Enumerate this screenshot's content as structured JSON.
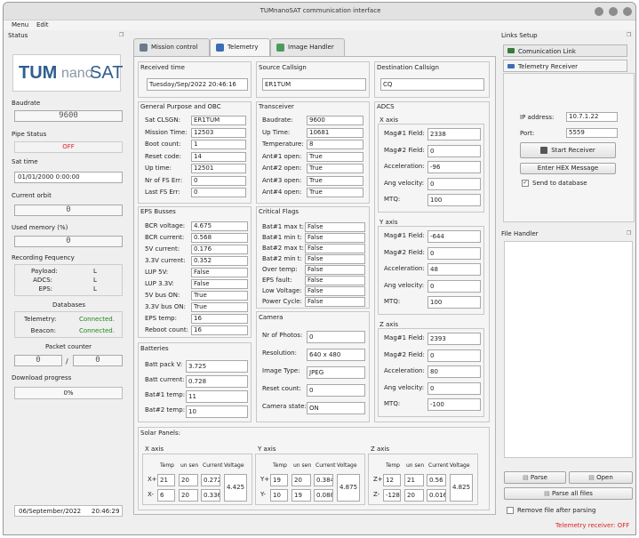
{
  "window": {
    "title": "TUMnanoSAT communication interface"
  },
  "menu": {
    "items": [
      "Menu",
      "Edit"
    ]
  },
  "left": {
    "status_title": "Status",
    "logo": {
      "text_tum": "TUM",
      "text_nano": "nano",
      "text_sat": "SAT"
    },
    "baudrate_label": "Baudrate",
    "baudrate_value": "9600",
    "pipe_status_label": "Pipe Status",
    "pipe_status_value": "OFF",
    "sat_time_label": "Sat time",
    "sat_time_value": "01/01/2000  0:00:00",
    "current_orbit_label": "Current orbit",
    "current_orbit_value": "0",
    "used_memory_label": "Used memory (%)",
    "used_memory_value": "0",
    "recording_label": "Recording Fequency",
    "recording_rows": [
      {
        "name": "Payload:",
        "value": "L"
      },
      {
        "name": "ADCS:",
        "value": "L"
      },
      {
        "name": "EPS:",
        "value": "L"
      }
    ],
    "databases_label": "Databases",
    "database_rows": [
      {
        "name": "Telemetry:",
        "value": "Connected."
      },
      {
        "name": "Beacon:",
        "value": "Connected."
      }
    ],
    "packet_counter_label": "Packet counter",
    "packet_counter_left": "0",
    "packet_counter_sep": "/",
    "packet_counter_right": "0",
    "download_label": "Download progress",
    "download_value": "0%",
    "footer_date": "06/September/2022",
    "footer_time": "20:46:29"
  },
  "tabs": [
    {
      "label": "Mission control"
    },
    {
      "label": "Telemetry"
    },
    {
      "label": "Image Handler"
    }
  ],
  "telemetry": {
    "received_time_label": "Received time",
    "received_time_value": "Tuesday/Sep/2022    20:46:16",
    "source_callsign_label": "Source Callsign",
    "source_callsign_value": "ER1TUM",
    "dest_callsign_label": "Destination Callsign",
    "dest_callsign_value": "CQ",
    "gp_title": "General Purpose and OBC",
    "gp_rows": [
      {
        "label": "Sat CLSGN:",
        "value": "ER1TUM"
      },
      {
        "label": "Mission Time:",
        "value": "12503"
      },
      {
        "label": "Boot count:",
        "value": "1"
      },
      {
        "label": "Reset code:",
        "value": "14"
      },
      {
        "label": "Up time:",
        "value": "12501"
      },
      {
        "label": "Nr of FS Err:",
        "value": "0"
      },
      {
        "label": "Last FS Err:",
        "value": "0"
      }
    ],
    "trx_title": "Transceiver",
    "trx_rows": [
      {
        "label": "Baudrate:",
        "value": "9600"
      },
      {
        "label": "Up Time:",
        "value": "10681"
      },
      {
        "label": "Temperature:",
        "value": "8"
      },
      {
        "label": "Ant#1 open:",
        "value": "True"
      },
      {
        "label": "Ant#2 open:",
        "value": "True"
      },
      {
        "label": "Ant#3 open:",
        "value": "True"
      },
      {
        "label": "Ant#4 open:",
        "value": "True"
      }
    ],
    "eps_title": "EPS Busses",
    "eps_rows": [
      {
        "label": "BCR voltage:",
        "value": "4.675"
      },
      {
        "label": "BCR current:",
        "value": "0.568"
      },
      {
        "label": "5V current:",
        "value": "0.176"
      },
      {
        "label": "3.3V current:",
        "value": "0.352"
      },
      {
        "label": "LUP 5V:",
        "value": "False"
      },
      {
        "label": "LUP 3.3V:",
        "value": "False"
      },
      {
        "label": "5V bus ON:",
        "value": "True"
      },
      {
        "label": "3.3V bus ON:",
        "value": "True"
      },
      {
        "label": "EPS temp:",
        "value": "16"
      },
      {
        "label": "Reboot count:",
        "value": "16"
      }
    ],
    "crit_title": "Critical Flags",
    "crit_rows": [
      {
        "label": "Bat#1 max t:",
        "value": "False"
      },
      {
        "label": "Bat#1 min t:",
        "value": "False"
      },
      {
        "label": "Bat#2 max t:",
        "value": "False"
      },
      {
        "label": "Bat#2 min t:",
        "value": "False"
      },
      {
        "label": "Over temp:",
        "value": "False"
      },
      {
        "label": "EPS fault:",
        "value": "False"
      },
      {
        "label": "Low Voltage:",
        "value": "False"
      },
      {
        "label": "Power Cycle:",
        "value": "False"
      }
    ],
    "bat_title": "Batteries",
    "bat_rows": [
      {
        "label": "Batt pack V:",
        "value": "3.725"
      },
      {
        "label": "Batt current:",
        "value": "0.728"
      },
      {
        "label": "Bat#1 temp:",
        "value": "11"
      },
      {
        "label": "Bat#2 temp:",
        "value": "10"
      }
    ],
    "cam_title": "Camera",
    "cam_rows": [
      {
        "label": "Nr of Photos:",
        "value": "0"
      },
      {
        "label": "Resolution:",
        "value": "640 x 480"
      },
      {
        "label": "Image Type:",
        "value": "JPEG"
      },
      {
        "label": "Reset count:",
        "value": "0"
      },
      {
        "label": "Camera state:",
        "value": "ON"
      }
    ],
    "adcs_title": "ADCS",
    "adcs_axes": [
      {
        "title": "X axis",
        "rows": [
          {
            "label": "Mag#1 Field:",
            "value": "2338"
          },
          {
            "label": "Mag#2 Field:",
            "value": "0"
          },
          {
            "label": "Acceleration:",
            "value": "-96"
          },
          {
            "label": "Ang velocity:",
            "value": "0"
          },
          {
            "label": "MTQ:",
            "value": "100"
          }
        ]
      },
      {
        "title": "Y axis",
        "rows": [
          {
            "label": "Mag#1 Field:",
            "value": "-644"
          },
          {
            "label": "Mag#2 Field:",
            "value": "0"
          },
          {
            "label": "Acceleration:",
            "value": "48"
          },
          {
            "label": "Ang velocity:",
            "value": "0"
          },
          {
            "label": "MTQ:",
            "value": "100"
          }
        ]
      },
      {
        "title": "Z axis",
        "rows": [
          {
            "label": "Mag#1 Field:",
            "value": "2393"
          },
          {
            "label": "Mag#2 Field:",
            "value": "0"
          },
          {
            "label": "Acceleration:",
            "value": "80"
          },
          {
            "label": "Ang velocity:",
            "value": "0"
          },
          {
            "label": "MTQ:",
            "value": "-100"
          }
        ]
      }
    ],
    "solar_title": "Solar Panels:",
    "solar_headers": [
      "Temp",
      "un sen",
      "Current",
      "Voltage"
    ],
    "solar_groups": [
      {
        "title": "X axis",
        "rows": [
          {
            "side": "X+",
            "temp": "21",
            "sun": "20",
            "current": "0.272"
          },
          {
            "side": "X-",
            "temp": "6",
            "sun": "20",
            "current": "0.336"
          }
        ],
        "voltage": "4.425"
      },
      {
        "title": "Y axis",
        "rows": [
          {
            "side": "Y+",
            "temp": "19",
            "sun": "20",
            "current": "0.384"
          },
          {
            "side": "Y-",
            "temp": "10",
            "sun": "19",
            "current": "0.088"
          }
        ],
        "voltage": "4.875"
      },
      {
        "title": "Z axis",
        "rows": [
          {
            "side": "Z+",
            "temp": "12",
            "sun": "21",
            "current": "0.56"
          },
          {
            "side": "Z-",
            "temp": "-128",
            "sun": "20",
            "current": "0.016"
          }
        ],
        "voltage": "4.825"
      }
    ]
  },
  "right": {
    "links_title": "Links Setup",
    "tab_comm": "Comunication Link",
    "tab_telemetry": "Telemetry Receiver",
    "ip_label": "IP address:",
    "ip_value": "10.7.1.22",
    "port_label": "Port:",
    "port_value": "5559",
    "start_receiver": "Start Receiver",
    "enter_hex": "Enter HEX Message",
    "send_db_label": "Send to database",
    "file_handler_title": "File Handler",
    "parse_label": "Parse",
    "open_label": "Open",
    "parse_all_label": "Parse all files",
    "remove_after_label": "Remove file after parsing",
    "status_text": "Telemetry receiver: OFF"
  },
  "colors": {
    "logo_blue": "#2f5e8e",
    "logo_gray": "#8a97a4",
    "green": "#1a8a1a",
    "red": "#e02020"
  }
}
